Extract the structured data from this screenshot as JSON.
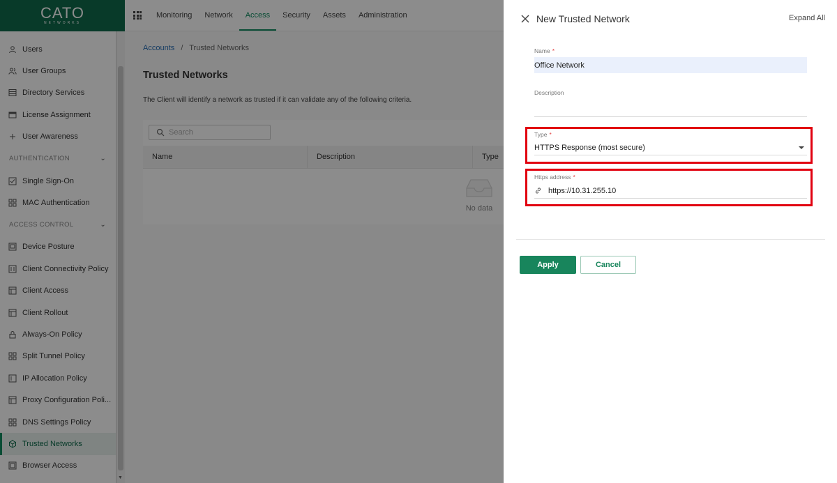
{
  "logo": {
    "brand": "CATO",
    "sub": "NETWORKS"
  },
  "topnav": {
    "tabs": [
      {
        "label": "Monitoring",
        "active": false
      },
      {
        "label": "Network",
        "active": false
      },
      {
        "label": "Access",
        "active": true
      },
      {
        "label": "Security",
        "active": false
      },
      {
        "label": "Assets",
        "active": false
      },
      {
        "label": "Administration",
        "active": false
      }
    ]
  },
  "sidebar": {
    "top_items": [
      {
        "label": "Users",
        "icon": "user-icon"
      },
      {
        "label": "User Groups",
        "icon": "users-icon"
      },
      {
        "label": "Directory Services",
        "icon": "directory-icon"
      },
      {
        "label": "License Assignment",
        "icon": "license-icon"
      },
      {
        "label": "User Awareness",
        "icon": "plus-icon"
      }
    ],
    "auth_section": "AUTHENTICATION",
    "auth_items": [
      {
        "label": "Single Sign-On",
        "icon": "checkbox-icon"
      },
      {
        "label": "MAC Authentication",
        "icon": "grid-icon"
      }
    ],
    "access_section": "ACCESS CONTROL",
    "access_items": [
      {
        "label": "Device Posture",
        "icon": "device-icon"
      },
      {
        "label": "Client Connectivity Policy",
        "icon": "policy-icon"
      },
      {
        "label": "Client Access",
        "icon": "layout-icon"
      },
      {
        "label": "Client Rollout",
        "icon": "layout-icon"
      },
      {
        "label": "Always-On Policy",
        "icon": "lock-icon"
      },
      {
        "label": "Split Tunnel Policy",
        "icon": "split-icon"
      },
      {
        "label": "IP Allocation Policy",
        "icon": "ip-icon"
      },
      {
        "label": "Proxy Configuration Poli...",
        "icon": "proxy-icon"
      },
      {
        "label": "DNS Settings Policy",
        "icon": "dns-icon"
      },
      {
        "label": "Trusted Networks",
        "icon": "shield-icon",
        "active": true
      },
      {
        "label": "Browser Access",
        "icon": "browser-icon"
      }
    ]
  },
  "main": {
    "breadcrumb": {
      "root": "Accounts",
      "separator": "/",
      "current": "Trusted Networks"
    },
    "title": "Trusted Networks",
    "description": "The Client will identify a network as trusted if it can validate any of the following criteria.",
    "search_placeholder": "Search",
    "columns": [
      "Name",
      "Description",
      "Type"
    ],
    "empty_text": "No data"
  },
  "drawer": {
    "title": "New Trusted Network",
    "expand_all": "Expand All",
    "name_label": "Name",
    "name_value": "Office Network",
    "description_label": "Description",
    "description_value": "",
    "type_label": "Type",
    "type_value": "HTTPS Response (most secure)",
    "https_label": "Https address",
    "https_value": "https://10.31.255.10",
    "required_mark": "*",
    "apply_label": "Apply",
    "cancel_label": "Cancel"
  },
  "colors": {
    "brand": "#0f6b4c",
    "accent": "#18855c",
    "highlight": "#e1000f",
    "required": "#e23b3b"
  }
}
